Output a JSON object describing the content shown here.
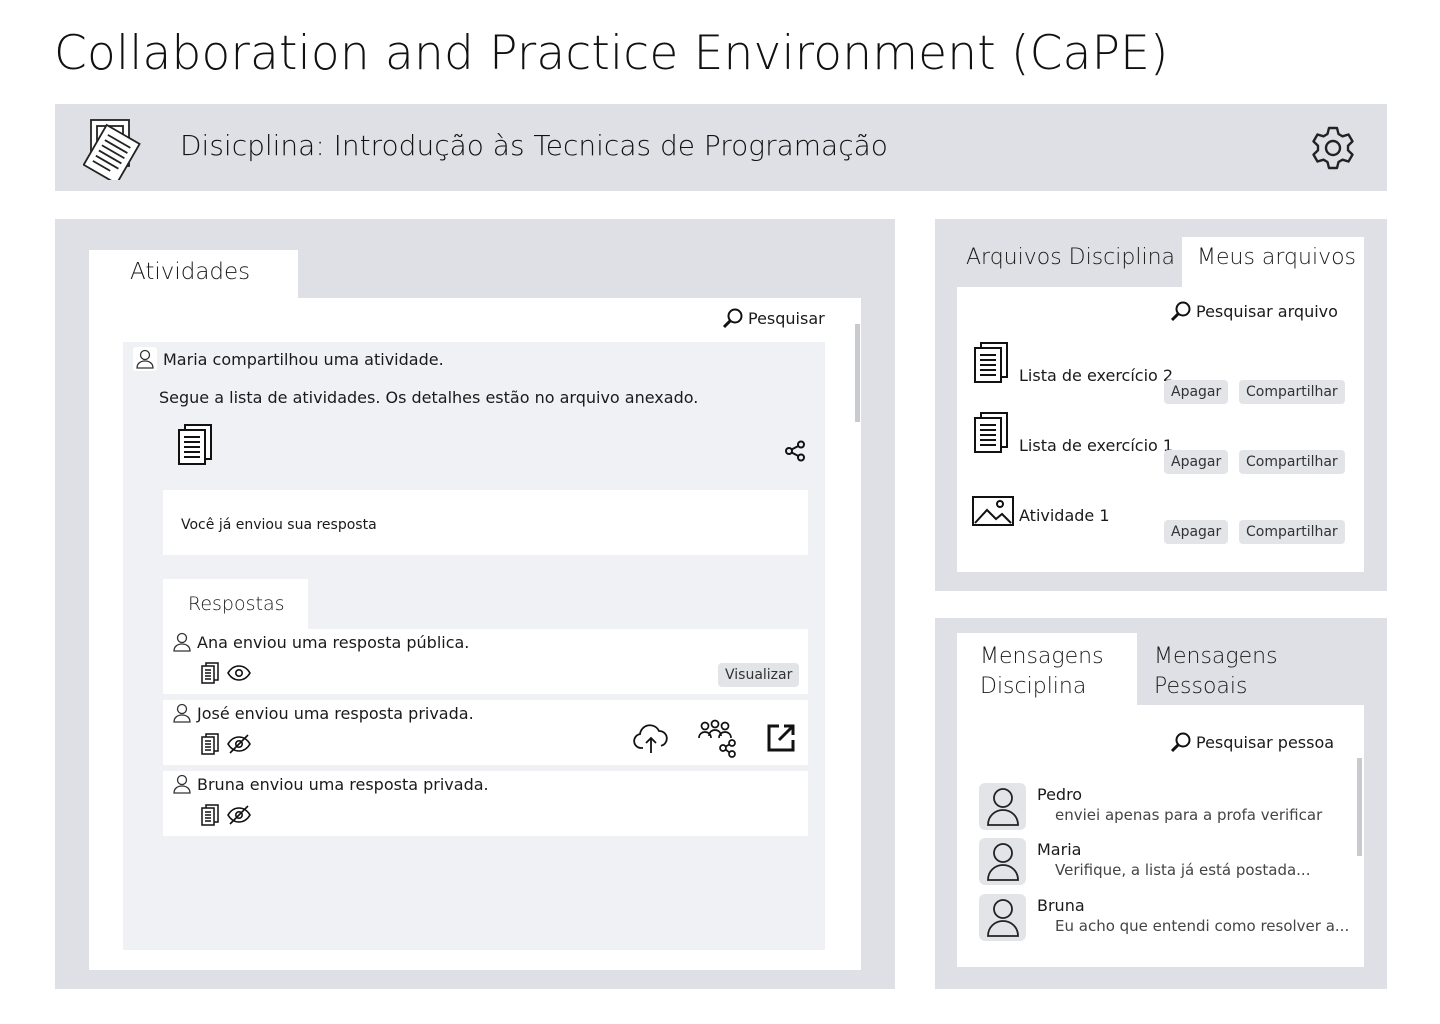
{
  "app": {
    "title": "Collaboration and Practice Environment (CaPE)"
  },
  "header": {
    "title": "Disicplina: Introdução às Tecnicas de Programação",
    "icon": "documents-icon",
    "settings_icon": "gear-icon"
  },
  "activities": {
    "tab_label": "Atividades",
    "search_label": "Pesquisar",
    "post": {
      "author_line": "Maria compartilhou uma atividade.",
      "text": "Segue a lista de atividades. Os detalhes estão no arquivo anexado.",
      "status": "Você já enviou sua resposta"
    },
    "responses": {
      "tab_label": "Respostas",
      "items": [
        {
          "text": "Ana enviou uma resposta pública.",
          "visibility": "public",
          "button": "Visualizar"
        },
        {
          "text": "José enviou uma resposta privada.",
          "visibility": "private"
        },
        {
          "text": "Bruna enviou uma resposta privada.",
          "visibility": "private"
        }
      ]
    }
  },
  "files": {
    "tabs": [
      "Arquivos Disciplina",
      "Meus arquivos"
    ],
    "active_tab": "Meus arquivos",
    "search_label": "Pesquisar arquivo",
    "items": [
      {
        "name": "Lista de exercício 2",
        "type": "document",
        "delete_label": "Apagar",
        "share_label": "Compartilhar"
      },
      {
        "name": "Lista de exercício 1",
        "type": "document",
        "delete_label": "Apagar",
        "share_label": "Compartilhar"
      },
      {
        "name": "Atividade 1",
        "type": "image",
        "delete_label": "Apagar",
        "share_label": "Compartilhar"
      }
    ]
  },
  "messages": {
    "tabs": [
      "Mensagens Disciplina",
      "Mensagens Pessoais"
    ],
    "tab1_lines": [
      "Mensagens",
      "Disciplina"
    ],
    "tab2_lines": [
      "Mensagens",
      "Pessoais"
    ],
    "active_tab": "Mensagens Disciplina",
    "search_label": "Pesquisar pessoa",
    "items": [
      {
        "name": "Pedro",
        "text": "enviei apenas para a profa verificar"
      },
      {
        "name": "Maria",
        "text": "Verifique, a lista já está postada..."
      },
      {
        "name": "Bruna",
        "text": "Eu acho que entendi  como resolver a..."
      }
    ]
  },
  "colors": {
    "panel_bg": "#dfe0e5",
    "feed_bg": "#f0f1f5",
    "button_bg": "#e3e4e8"
  }
}
